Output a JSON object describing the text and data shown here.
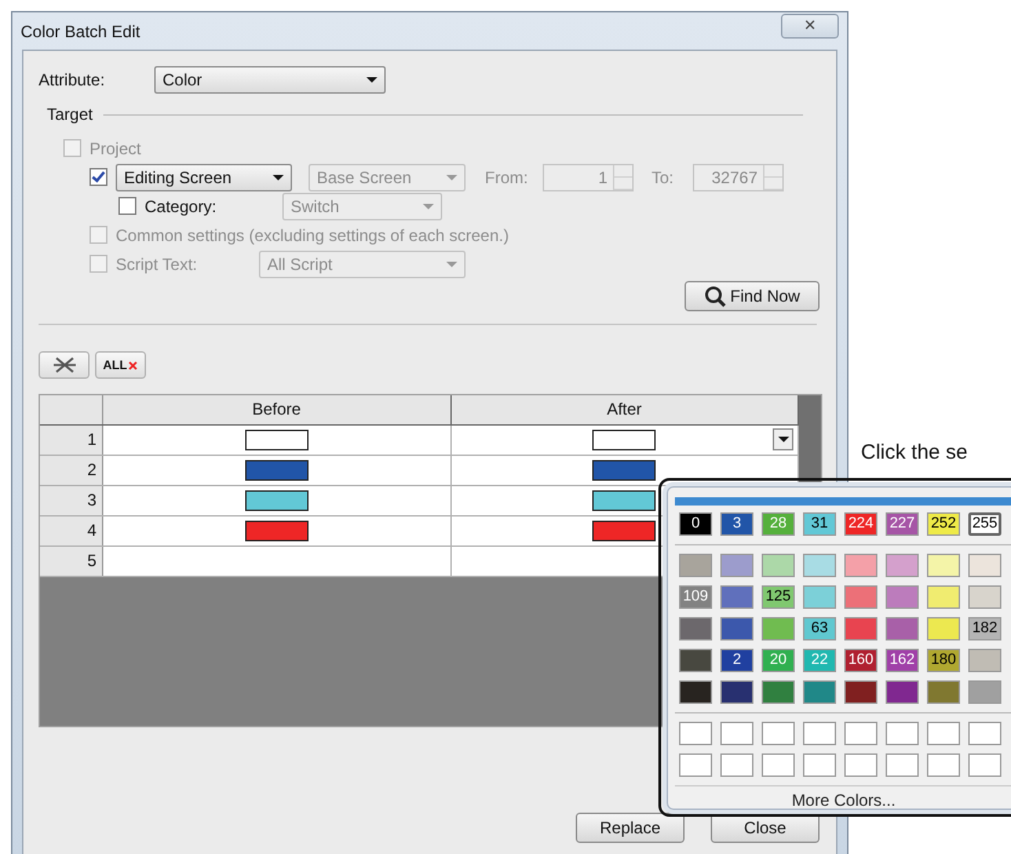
{
  "window": {
    "title": "Color Batch Edit",
    "close": "✕"
  },
  "attribute": {
    "label": "Attribute:",
    "value": "Color"
  },
  "target": {
    "title": "Target",
    "project": {
      "label": "Project",
      "checked": false,
      "disabled": true
    },
    "editing": {
      "checked": true,
      "value": "Editing Screen",
      "screen_type": "Base Screen",
      "from_label": "From:",
      "from": "1",
      "to_label": "To:",
      "to": "32767"
    },
    "category": {
      "label": "Category:",
      "checked": false,
      "value": "Switch"
    },
    "common": {
      "label": "Common settings (excluding settings of each screen.)",
      "checked": false,
      "disabled": true
    },
    "script": {
      "label": "Script Text:",
      "checked": false,
      "disabled": true,
      "value": "All Script"
    }
  },
  "find_button": "Find Now",
  "toolbar": {
    "delete_all_label": "ALL"
  },
  "table": {
    "columns": [
      "Before",
      "After"
    ],
    "rows": [
      {
        "number": "1",
        "before": {
          "color": "#ffffff"
        },
        "after": {
          "color": "#ffffff"
        },
        "dropdown": true
      },
      {
        "number": "2",
        "before": {
          "color": "#2155a8"
        },
        "after": {
          "color": "#2155a8"
        },
        "dropdown": false
      },
      {
        "number": "3",
        "before": {
          "color": "#62c8d6"
        },
        "after": {
          "color": "#62c8d6"
        },
        "dropdown": false
      },
      {
        "number": "4",
        "before": {
          "color": "#ee2626"
        },
        "after": {
          "color": "#ee2626"
        },
        "dropdown": false
      },
      {
        "number": "5",
        "dropdown": false
      }
    ]
  },
  "buttons": [
    "Replace",
    "Close"
  ],
  "callout": "Click the se",
  "palette": {
    "top": [
      {
        "label": "0",
        "color": "#000000",
        "selected": false
      },
      {
        "label": "3",
        "color": "#2155a8",
        "selected": false
      },
      {
        "label": "28",
        "color": "#55b03c",
        "selected": false
      },
      {
        "label": "31",
        "color": "#62c8d6",
        "selected": false
      },
      {
        "label": "224",
        "color": "#ee2626",
        "selected": false
      },
      {
        "label": "227",
        "color": "#a655a6",
        "selected": false
      },
      {
        "label": "252",
        "color": "#eeea48",
        "selected": false
      },
      {
        "label": "255",
        "color": "#ffffff",
        "selected": true
      }
    ],
    "rows": [
      [
        {
          "color": "#a8a49c"
        },
        {
          "color": "#9c9ccc"
        },
        {
          "color": "#acd8a8"
        },
        {
          "color": "#a8dce4"
        },
        {
          "color": "#f4a0a8"
        },
        {
          "color": "#d4a0cc"
        },
        {
          "color": "#f4f4a8"
        },
        {
          "color": "#ece4dc"
        }
      ],
      [
        {
          "color": "#828282",
          "label": "109"
        },
        {
          "color": "#6070bc"
        },
        {
          "color": "#80c870",
          "label": "125"
        },
        {
          "color": "#7cd0d8"
        },
        {
          "color": "#ec7078"
        },
        {
          "color": "#bc7cbc"
        },
        {
          "color": "#f0ec70"
        },
        {
          "color": "#d8d4cc"
        }
      ],
      [
        {
          "color": "#6c686c"
        },
        {
          "color": "#3c58ac"
        },
        {
          "color": "#70bc50"
        },
        {
          "color": "#60c8d0",
          "label": "63"
        },
        {
          "color": "#e84450"
        },
        {
          "color": "#a860a8"
        },
        {
          "color": "#ece850"
        },
        {
          "color": "#b4b4b4",
          "label": "182"
        }
      ],
      [
        {
          "color": "#484840"
        },
        {
          "color": "#2040a0",
          "label": "2"
        },
        {
          "color": "#30b050",
          "label": "20"
        },
        {
          "color": "#20b8b0",
          "label": "22"
        },
        {
          "color": "#b02030",
          "label": "160"
        },
        {
          "color": "#a040a8",
          "label": "162"
        },
        {
          "color": "#b0a830",
          "label": "180"
        },
        {
          "color": "#c0bcb4"
        }
      ],
      [
        {
          "color": "#282420"
        },
        {
          "color": "#283070"
        },
        {
          "color": "#308040"
        },
        {
          "color": "#208888"
        },
        {
          "color": "#802020"
        },
        {
          "color": "#802890"
        },
        {
          "color": "#807830"
        },
        {
          "color": "#a0a0a0"
        }
      ]
    ],
    "custom": [
      [
        {
          "color": "#ffffff"
        },
        {
          "color": "#ffffff"
        },
        {
          "color": "#ffffff"
        },
        {
          "color": "#ffffff"
        },
        {
          "color": "#ffffff"
        },
        {
          "color": "#ffffff"
        },
        {
          "color": "#ffffff"
        },
        {
          "color": "#ffffff"
        }
      ],
      [
        {
          "color": "#ffffff"
        },
        {
          "color": "#ffffff"
        },
        {
          "color": "#ffffff"
        },
        {
          "color": "#ffffff"
        },
        {
          "color": "#ffffff"
        },
        {
          "color": "#ffffff"
        },
        {
          "color": "#ffffff"
        },
        {
          "color": "#ffffff"
        }
      ]
    ],
    "more": "More Colors..."
  }
}
